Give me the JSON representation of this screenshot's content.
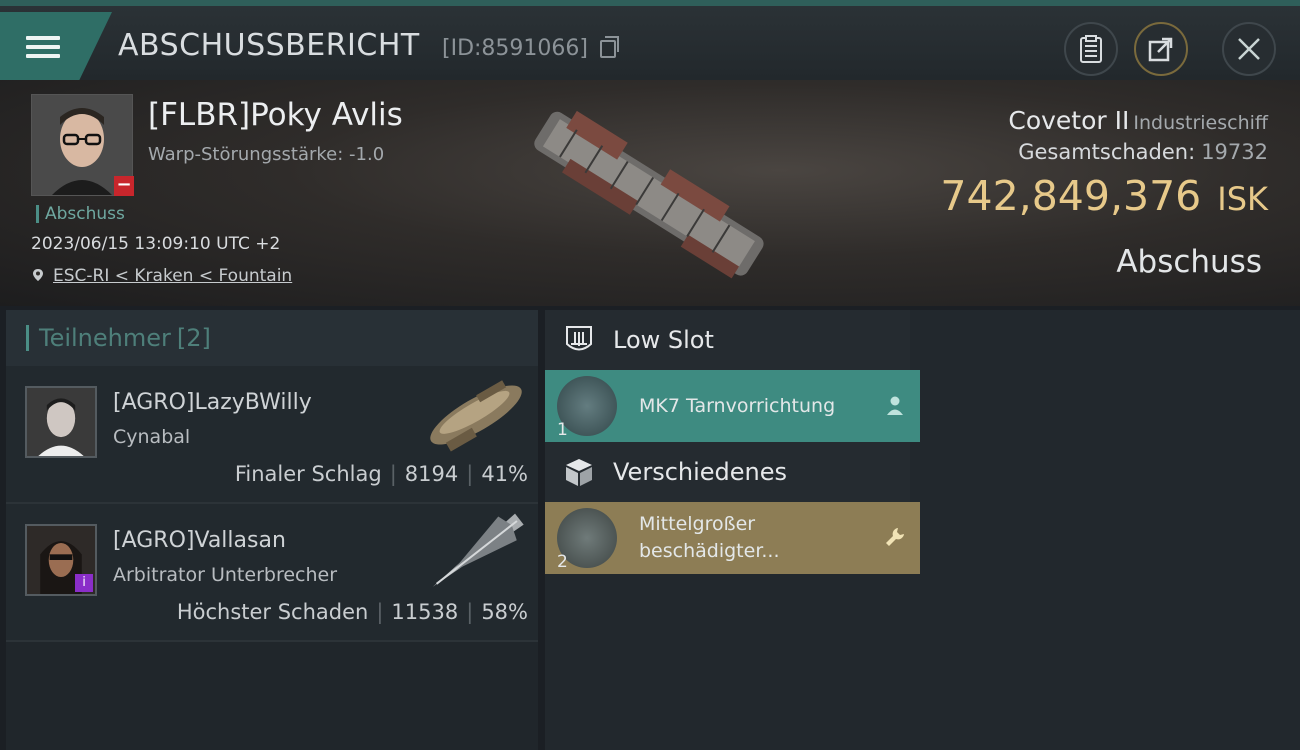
{
  "header": {
    "title": "ABSCHUSSBERICHT",
    "report_id": "[ID:8591066]",
    "buttons": [
      "clipboard-icon",
      "share-icon",
      "close-icon"
    ]
  },
  "victim": {
    "name": "[FLBR]Poky Avlis",
    "warp_strength": "Warp-Störungsstärke: -1.0",
    "status_tag": "Abschuss",
    "datetime": "2023/06/15 13:09:10 UTC +2",
    "location": "ESC-RI < Kraken < Fountain",
    "ship_name": "Covetor II",
    "ship_class": "Industrieschiff",
    "total_damage_label": "Gesamtschaden:",
    "total_damage_value": "19732",
    "isk_value": "742,849,376",
    "isk_unit": "ISK",
    "kill_type": "Abschuss"
  },
  "participants": {
    "title": "Teilnehmer",
    "count": "[2]",
    "list": [
      {
        "name": "[AGRO]LazyBWilly",
        "ship": "Cynabal",
        "role": "Finaler Schlag",
        "damage": "8194",
        "percent": "41%"
      },
      {
        "name": "[AGRO]Vallasan",
        "ship": "Arbitrator Unterbrecher",
        "role": "Höchster Schaden",
        "damage": "11538",
        "percent": "58%"
      }
    ]
  },
  "slots": {
    "low_slot": {
      "title": "Low Slot",
      "items": [
        {
          "qty": "1",
          "name": "MK7 Tarnvorrichtung",
          "status": "fitted"
        }
      ]
    },
    "misc": {
      "title": "Verschiedenes",
      "items": [
        {
          "qty": "2",
          "name": "Mittelgroßer beschädigter...",
          "status": "damaged"
        }
      ]
    }
  },
  "colors": {
    "accent_teal": "#3e8b81",
    "isk_gold": "#e7c98a",
    "damaged_tan": "#8d7d55",
    "badge_red": "#c8262c",
    "badge_purple": "#8a2ec9"
  }
}
